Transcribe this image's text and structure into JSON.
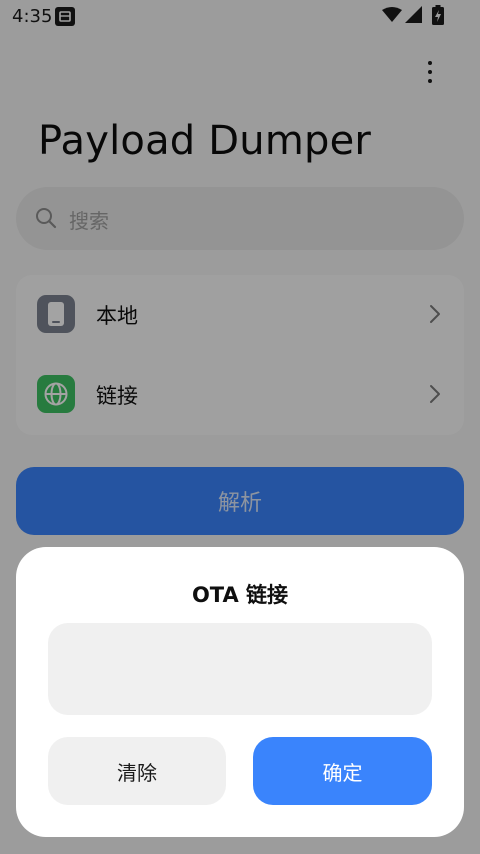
{
  "status_bar": {
    "time": "4:35",
    "icons": [
      "screenshot-icon",
      "wifi-icon",
      "signal-icon",
      "battery-charging-icon"
    ]
  },
  "app": {
    "title": "Payload Dumper",
    "menu_icon": "more-vertical-icon"
  },
  "search": {
    "placeholder": "搜索",
    "icon": "search-icon"
  },
  "sources": [
    {
      "label": "本地",
      "icon": "phone-icon",
      "color": "#7c8290"
    },
    {
      "label": "链接",
      "icon": "globe-icon",
      "color": "#3ec063"
    }
  ],
  "parse_button": {
    "label": "解析"
  },
  "dialog": {
    "title": "OTA 链接",
    "input_value": "",
    "clear_label": "清除",
    "confirm_label": "确定"
  },
  "colors": {
    "accent": "#3a84fc",
    "background": "#f4f4f4",
    "scrim": "rgba(0,0,0,0.36)"
  }
}
